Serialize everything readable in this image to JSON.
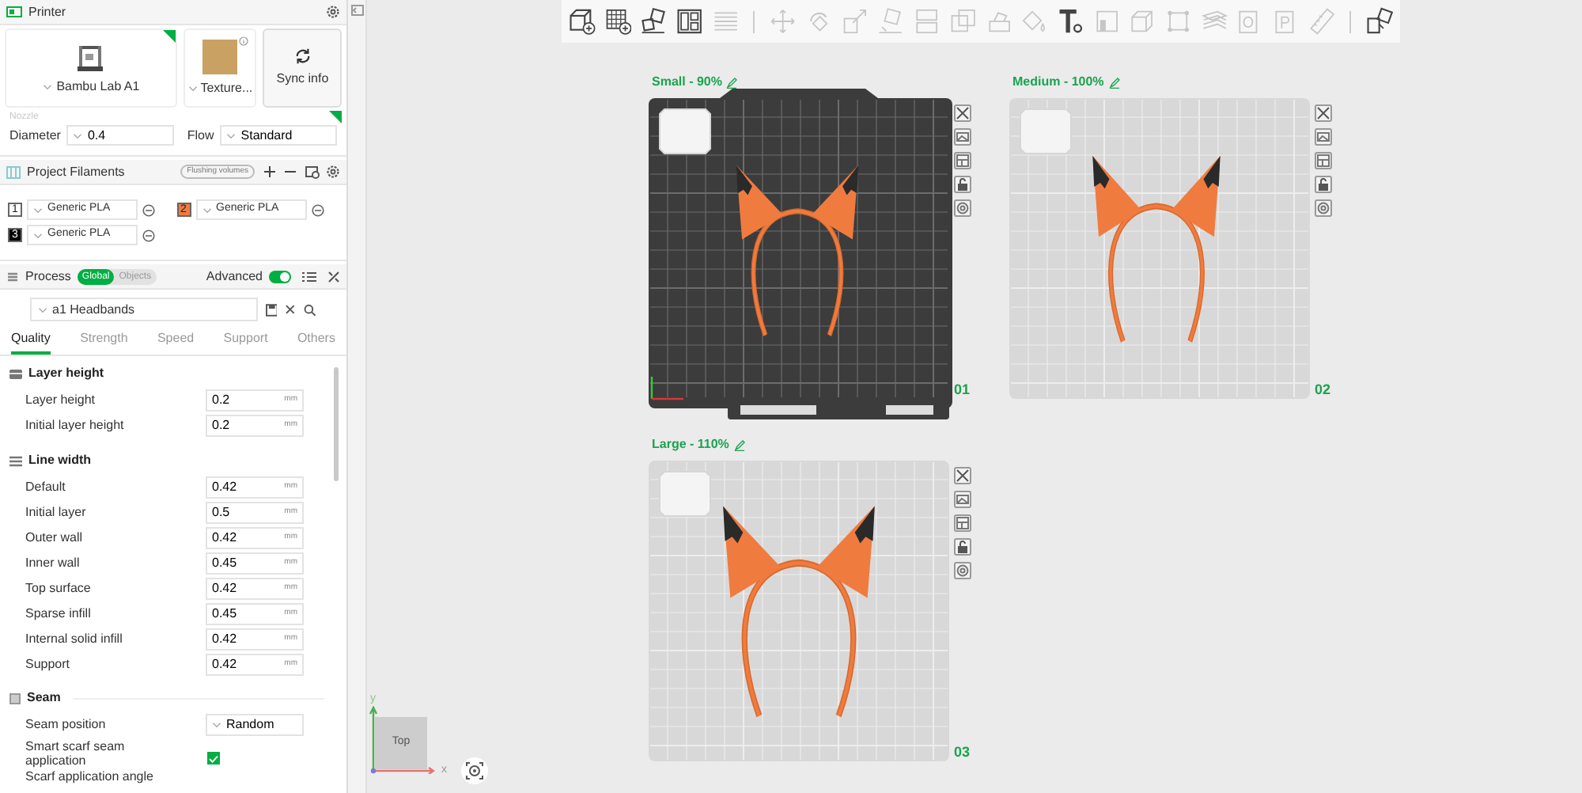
{
  "printer": {
    "title": "Printer",
    "printer_name": "Bambu Lab A1",
    "plate_type": "Texture...",
    "sync_button": "Sync info",
    "nozzle_label": "Nozzle",
    "diameter_label": "Diameter",
    "diameter": "0.4",
    "flow_label": "Flow",
    "flow": "Standard"
  },
  "filaments": {
    "title": "Project Filaments",
    "flushing_button": "Flushing volumes",
    "items": [
      {
        "index": "1",
        "name": "Generic PLA",
        "color": "#ffffff"
      },
      {
        "index": "2",
        "name": "Generic PLA",
        "color": "#f07b3f"
      },
      {
        "index": "3",
        "name": "Generic PLA",
        "color": "#000000"
      }
    ]
  },
  "process": {
    "title": "Process",
    "scope": [
      {
        "label": "Global",
        "selected": true
      },
      {
        "label": "Objects",
        "selected": false
      }
    ],
    "advanced_label": "Advanced",
    "advanced": true,
    "preset": "a1 Headbands",
    "tabs": [
      {
        "label": "Quality",
        "selected": true
      },
      {
        "label": "Strength",
        "selected": false
      },
      {
        "label": "Speed",
        "selected": false
      },
      {
        "label": "Support",
        "selected": false
      },
      {
        "label": "Others",
        "selected": false
      }
    ],
    "sections": [
      {
        "title": "Layer height",
        "rows": [
          {
            "kind": "input",
            "label": "Layer height",
            "value": "0.2",
            "unit": "mm"
          },
          {
            "kind": "input",
            "label": "Initial layer height",
            "value": "0.2",
            "unit": "mm"
          }
        ]
      },
      {
        "title": "Line width",
        "rows": [
          {
            "kind": "input",
            "label": "Default",
            "value": "0.42",
            "unit": "mm"
          },
          {
            "kind": "input",
            "label": "Initial layer",
            "value": "0.5",
            "unit": "mm"
          },
          {
            "kind": "input",
            "label": "Outer wall",
            "value": "0.42",
            "unit": "mm"
          },
          {
            "kind": "input",
            "label": "Inner wall",
            "value": "0.45",
            "unit": "mm"
          },
          {
            "kind": "input",
            "label": "Top surface",
            "value": "0.42",
            "unit": "mm"
          },
          {
            "kind": "input",
            "label": "Sparse infill",
            "value": "0.45",
            "unit": "mm"
          },
          {
            "kind": "input",
            "label": "Internal solid infill",
            "value": "0.42",
            "unit": "mm"
          },
          {
            "kind": "input",
            "label": "Support",
            "value": "0.42",
            "unit": "mm"
          }
        ]
      },
      {
        "title": "Seam",
        "rows": [
          {
            "kind": "dropdown",
            "label": "Seam position",
            "value": "Random"
          },
          {
            "kind": "checkbox",
            "label": "Smart scarf seam application",
            "checked": true
          },
          {
            "kind": "label",
            "label": "Scarf application angle"
          }
        ]
      }
    ]
  },
  "toolbar": [
    {
      "kind": "button",
      "disabled": false
    },
    {
      "kind": "button",
      "disabled": false
    },
    {
      "kind": "button",
      "disabled": false
    },
    {
      "kind": "button",
      "disabled": false
    },
    {
      "kind": "button",
      "disabled": true
    },
    {
      "kind": "separator"
    },
    {
      "kind": "button",
      "disabled": true
    },
    {
      "kind": "button",
      "disabled": true
    },
    {
      "kind": "button",
      "disabled": true
    },
    {
      "kind": "button",
      "disabled": true
    },
    {
      "kind": "button",
      "disabled": true
    },
    {
      "kind": "button",
      "disabled": true
    },
    {
      "kind": "button",
      "disabled": true
    },
    {
      "kind": "button",
      "disabled": true
    },
    {
      "kind": "button",
      "disabled": false
    },
    {
      "kind": "button",
      "disabled": true
    },
    {
      "kind": "button",
      "disabled": true
    },
    {
      "kind": "button",
      "disabled": true
    },
    {
      "kind": "button",
      "disabled": true
    },
    {
      "kind": "button",
      "disabled": true
    },
    {
      "kind": "button",
      "disabled": true
    },
    {
      "kind": "button",
      "disabled": true
    },
    {
      "kind": "separator"
    },
    {
      "kind": "button",
      "disabled": false
    }
  ],
  "plates": [
    {
      "label": "Small - 90%",
      "number": "01",
      "selected": true
    },
    {
      "label": "Medium - 100%",
      "number": "02",
      "selected": false
    },
    {
      "label": "Large - 110%",
      "number": "03",
      "selected": false
    }
  ],
  "view_cube": {
    "face": "Top",
    "x_label": "x",
    "y_label": "y"
  }
}
